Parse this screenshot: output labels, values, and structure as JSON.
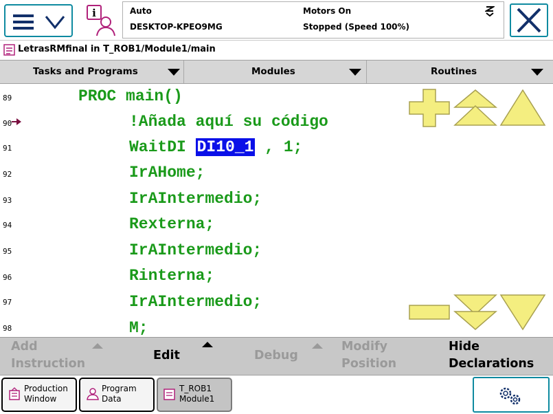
{
  "status": {
    "mode": "Auto",
    "controller": "DESKTOP-KPEO9MG",
    "motors": "Motors On",
    "run_state": "Stopped (Speed 100%)"
  },
  "title": "LetrasRMfinal in T_ROB1/Module1/main",
  "selectors": {
    "tasks": "Tasks and Programs",
    "modules": "Modules",
    "routines": "Routines"
  },
  "code_lines": [
    {
      "num": "89",
      "text": "PROC main()"
    },
    {
      "num": "90",
      "text": "!Añada aquí su código"
    },
    {
      "num": "91",
      "text_before": "WaitDI ",
      "selected": "DI10_1",
      "text_after": " , 1;"
    },
    {
      "num": "92",
      "text": "IrAHome;"
    },
    {
      "num": "93",
      "text": "IrAIntermedio;"
    },
    {
      "num": "94",
      "text": "Rexterna;"
    },
    {
      "num": "95",
      "text": "IrAIntermedio;"
    },
    {
      "num": "96",
      "text": "Rinterna;"
    },
    {
      "num": "97",
      "text": "IrAIntermedio;"
    },
    {
      "num": "98",
      "text": "M;"
    }
  ],
  "actions": {
    "add_instruction_1": "Add",
    "add_instruction_2": "Instruction",
    "edit": "Edit",
    "debug": "Debug",
    "modify_1": "Modify",
    "modify_2": "Position",
    "hide_1": "Hide",
    "hide_2": "Declarations"
  },
  "taskbar": {
    "production_1": "Production",
    "production_2": "Window",
    "program_data_1": "Program",
    "program_data_2": "Data",
    "module_1": "T_ROB1",
    "module_2": "Module1"
  },
  "icons": {
    "menu": "menu-icon",
    "info": "event-log-icon",
    "speed": "speed-icon",
    "close": "close-icon",
    "zoom_in": "plus-icon",
    "page_up": "double-up-icon",
    "scroll_up": "up-icon",
    "zoom_out": "minus-icon",
    "page_down": "double-down-icon",
    "scroll_down": "down-icon",
    "quickset": "gears-icon"
  },
  "colors": {
    "code": "#1a9a1a",
    "selection": "#0a10e8",
    "nav_button": "#f4ee80",
    "accent": "#0e8aa0"
  }
}
